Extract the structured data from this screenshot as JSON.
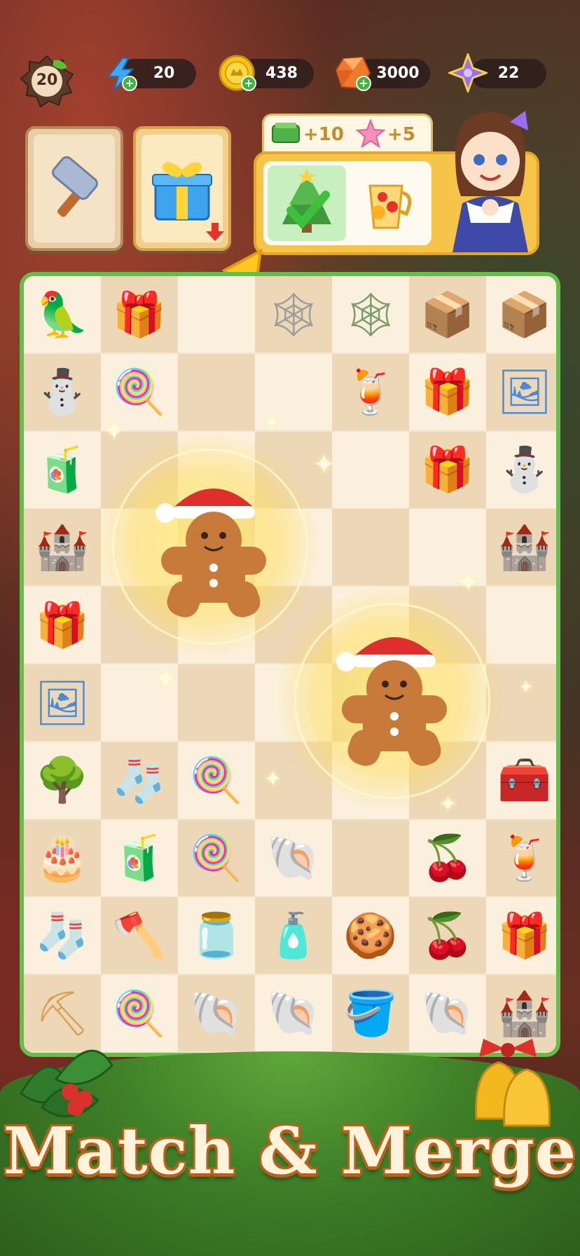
{
  "hud": {
    "level": "20",
    "energy": "20",
    "coins": "438",
    "gems": "3000",
    "stars": "22"
  },
  "task": {
    "reward_cash": "+10",
    "reward_star": "+5"
  },
  "board": {
    "rows": [
      [
        "parrot",
        "gift-blue",
        "",
        "cobweb-drink",
        "cobweb-plant",
        "box",
        "box"
      ],
      [
        "snowman",
        "candy-cane",
        "",
        "",
        "drink",
        "gift-orange",
        "photos"
      ],
      [
        "juice",
        "",
        "",
        "",
        "",
        "gift-orange",
        "snowman"
      ],
      [
        "sandcastle",
        "",
        "",
        "",
        "",
        "",
        "sandcastle"
      ],
      [
        "gift-purple",
        "",
        "",
        "",
        "",
        "",
        ""
      ],
      [
        "photos",
        "",
        "",
        "",
        "",
        "",
        ""
      ],
      [
        "tree-plant",
        "stocking",
        "candy-cane",
        "",
        "",
        "",
        "crate"
      ],
      [
        "cake",
        "juice-box",
        "candy-cane",
        "shell",
        "",
        "holly",
        "drink"
      ],
      [
        "stocking",
        "axe",
        "jam",
        "oil",
        "cookie",
        "holly",
        "gift-orange"
      ],
      [
        "sand-shovel",
        "candy-cane",
        "shell",
        "shell",
        "sand-bucket",
        "shell",
        "sandcastle"
      ]
    ]
  },
  "headline": "Match & Merge"
}
